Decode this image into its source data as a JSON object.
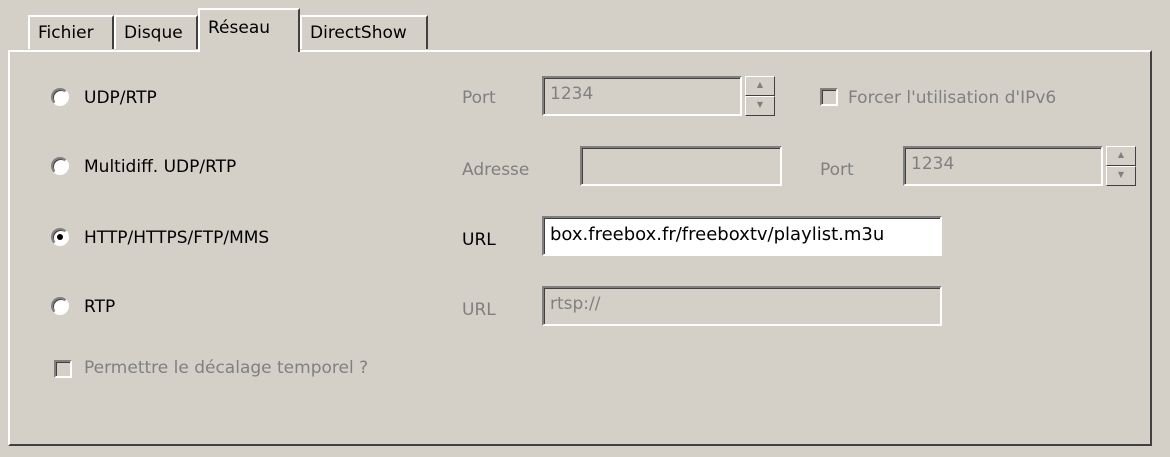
{
  "tabs": [
    "Fichier",
    "Disque",
    "Réseau",
    "DirectShow"
  ],
  "udp": {
    "label": "UDP/RTP",
    "port_label": "Port",
    "port_value": "1234",
    "ipv6_label": "Forcer l'utilisation d'IPv6"
  },
  "multicast": {
    "label": "Multidiff. UDP/RTP",
    "address_label": "Adresse",
    "address_value": "",
    "port_label": "Port",
    "port_value": "1234"
  },
  "http": {
    "label": "HTTP/HTTPS/FTP/MMS",
    "url_label": "URL",
    "url_value": "box.freebox.fr/freeboxtv/playlist.m3u"
  },
  "rtp": {
    "label": "RTP",
    "url_label": "URL",
    "url_value": "rtsp://"
  },
  "timeshift_label": "Permettre le décalage temporel ?"
}
